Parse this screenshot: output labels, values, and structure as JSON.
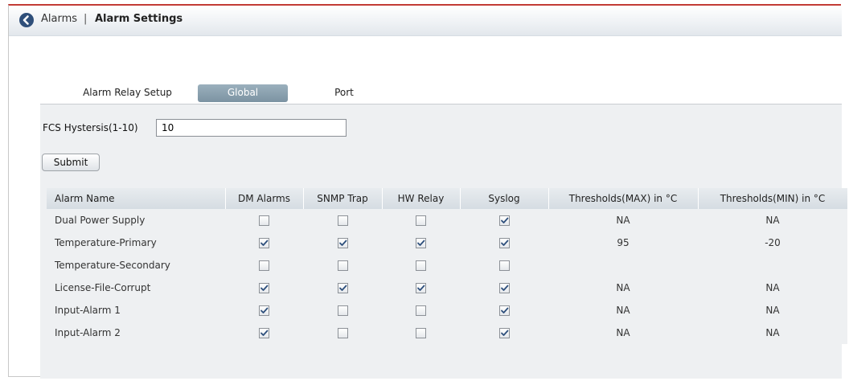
{
  "header": {
    "parent": "Alarms",
    "separator": "|",
    "current": "Alarm Settings"
  },
  "tabs": [
    {
      "label": "Alarm Relay Setup",
      "active": false
    },
    {
      "label": "Global",
      "active": true
    },
    {
      "label": "Port",
      "active": false
    }
  ],
  "form": {
    "fcs_label": "FCS Hystersis(1-10)",
    "fcs_value": "10",
    "submit_label": "Submit"
  },
  "table": {
    "columns": [
      "Alarm Name",
      "DM Alarms",
      "SNMP Trap",
      "HW Relay",
      "Syslog",
      "Thresholds(MAX) in °C",
      "Thresholds(MIN) in °C"
    ],
    "rows": [
      {
        "name": "Dual Power Supply",
        "dm": false,
        "snmp": false,
        "hw": false,
        "syslog": true,
        "max": "NA",
        "min": "NA"
      },
      {
        "name": "Temperature-Primary",
        "dm": true,
        "snmp": true,
        "hw": true,
        "syslog": true,
        "max": "95",
        "min": "-20"
      },
      {
        "name": "Temperature-Secondary",
        "dm": false,
        "snmp": false,
        "hw": false,
        "syslog": false,
        "max": "",
        "min": ""
      },
      {
        "name": "License-File-Corrupt",
        "dm": true,
        "snmp": true,
        "hw": true,
        "syslog": true,
        "max": "NA",
        "min": "NA"
      },
      {
        "name": "Input-Alarm 1",
        "dm": true,
        "snmp": false,
        "hw": false,
        "syslog": true,
        "max": "NA",
        "min": "NA"
      },
      {
        "name": "Input-Alarm 2",
        "dm": true,
        "snmp": false,
        "hw": false,
        "syslog": true,
        "max": "NA",
        "min": "NA"
      }
    ]
  },
  "colors": {
    "accent_border": "#c23b35",
    "back_button": "#2f4f7a",
    "tab_active": "#8aa0ae",
    "panel_bg": "#eef0f2"
  }
}
